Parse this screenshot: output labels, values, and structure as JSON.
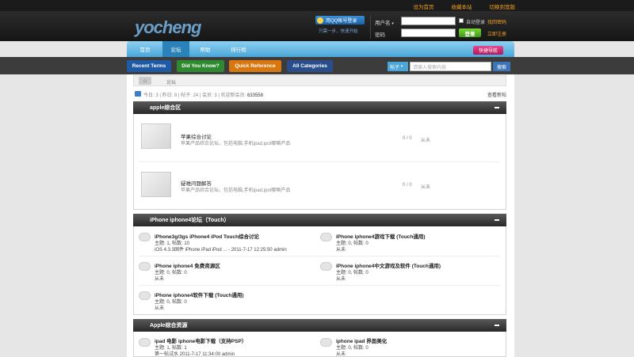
{
  "top_links": [
    "设为首页",
    "收藏本站",
    "切换到宽版"
  ],
  "logo": "yocheng",
  "qq_login": "用QQ帐号登录",
  "qq_hint": "只需一步，快速开始",
  "login": {
    "username_label": "用户名",
    "password_label": "密码",
    "auto_login": "自动登录",
    "forgot": "找回密码",
    "submit": "登录",
    "register": "立即注册"
  },
  "nav": {
    "home": "首页",
    "forum": "论坛",
    "help": "帮助",
    "rank": "排行榜",
    "quick": "快捷导航"
  },
  "topic_buttons": [
    "Recent Terms",
    "Did You Know?",
    "Quick Reference",
    "All Categories"
  ],
  "search": {
    "scope": "帖子",
    "placeholder": "请输入搜索内容",
    "button": "搜索"
  },
  "breadcrumb": "论坛",
  "stats": {
    "text": "今日: 3 | 昨日: 9 | 帖子: 24 | 会员: 3 | 欢迎新会员:",
    "new_member": "633558",
    "view_new": "查看新帖"
  },
  "sections": [
    {
      "title": "apple综合区",
      "forums": [
        {
          "title": "苹果综合讨论",
          "desc": "苹果产品综合论坛，包括电脑,手机ipad,ipot哪嘛产品",
          "count": "0 / 0",
          "last": "从未"
        },
        {
          "title": "疑难问题解答",
          "desc": "苹果产品综合论坛，包括电脑,手机ipad,ipot哪嘛产品",
          "count": "0 / 0",
          "last": "从未"
        }
      ]
    },
    {
      "title": "iPhone iphone4论坛（Touch）",
      "forums": [
        {
          "title": "iPhone3g/3gs iPhone4 iPod Touch综合讨论",
          "info": "主题: 1, 帖数: 10",
          "last": "iOS 4.3.3固件 iPhone iPad iPod ... - 2011-7-17 12:25:50 admin"
        },
        {
          "title": "iPhone iphone4游戏下载 (Touch通用)",
          "info": "主题: 0, 帖数: 0",
          "last": "从未"
        },
        {
          "title": "iPhone iphone4 免费资源区",
          "info": "主题: 0, 帖数: 0",
          "last": "从未"
        },
        {
          "title": "iPhone iphone4中文游戏及软件 (Touch通用)",
          "info": "主题: 0, 帖数: 0",
          "last": "从未"
        },
        {
          "title": "iPhone iphone4软件下载 (Touch通用)",
          "info": "主题: 0, 帖数: 0",
          "last": "从未"
        }
      ]
    },
    {
      "title": "Apple综合资源",
      "forums": [
        {
          "title": "ipad 电影 iphone电影下载（支持PSP）",
          "info": "主题: 1, 帖数: 1",
          "last": "第一帖试水 2011-7-17 11:34:00 admin"
        },
        {
          "title": "iphone ipad 界面美化",
          "info": "主题: 0, 帖数: 0",
          "last": "从未"
        }
      ]
    }
  ]
}
